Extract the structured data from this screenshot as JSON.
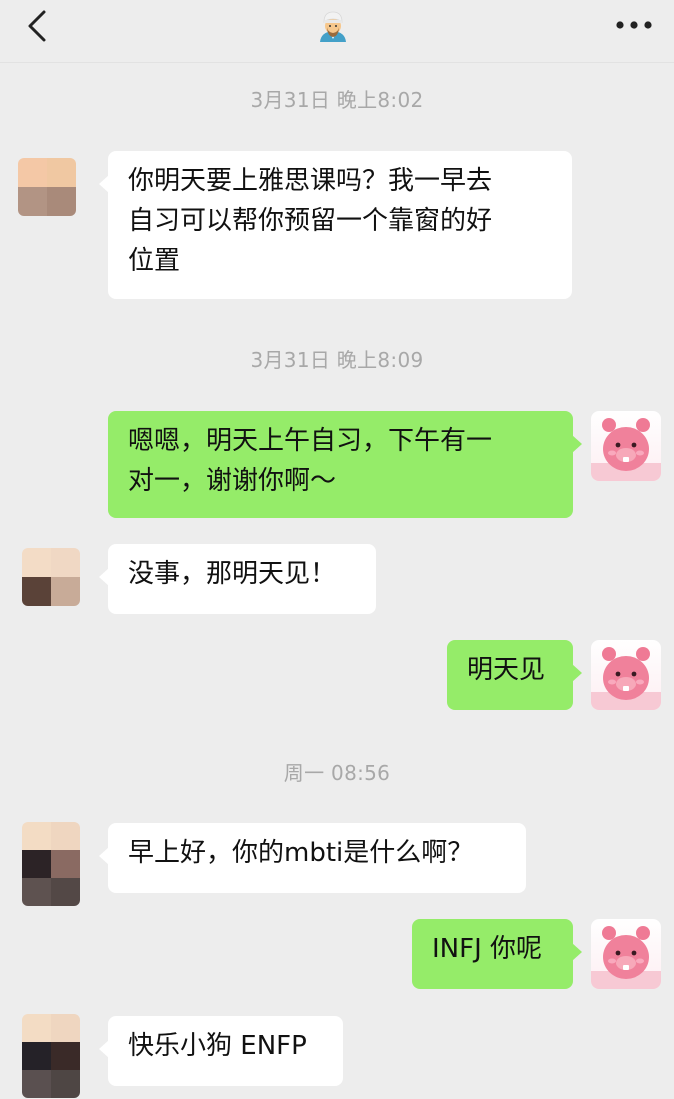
{
  "header": {
    "back_icon": "chevron-left-icon",
    "title_icon": "man-with-turban-emoji",
    "more_icon": "more-horizontal-icon"
  },
  "messages": [
    {
      "type": "time",
      "text": "3月31日 晚上8:02"
    },
    {
      "type": "in",
      "lines": [
        "你明天要上雅思课吗？我一早去",
        "自习可以帮你预留一个靠窗的好",
        "位置"
      ]
    },
    {
      "type": "time",
      "text": "3月31日 晚上8:09"
    },
    {
      "type": "out",
      "lines": [
        "嗯嗯，明天上午自习，下午有一",
        "对一，谢谢你啊～"
      ]
    },
    {
      "type": "in",
      "lines": [
        "没事，那明天见！"
      ]
    },
    {
      "type": "out",
      "lines": [
        "明天见"
      ]
    },
    {
      "type": "time",
      "text": "周一 08:56"
    },
    {
      "type": "in",
      "lines": [
        "早上好，你的mbti是什么啊？"
      ]
    },
    {
      "type": "out",
      "lines": [
        "INFJ 你呢"
      ]
    },
    {
      "type": "in",
      "lines": [
        "快乐小狗 ENFP"
      ]
    }
  ],
  "colors": {
    "background": "#ededed",
    "incoming_bubble": "#ffffff",
    "outgoing_bubble": "#95ec69",
    "timestamp": "#a8a8a8"
  }
}
